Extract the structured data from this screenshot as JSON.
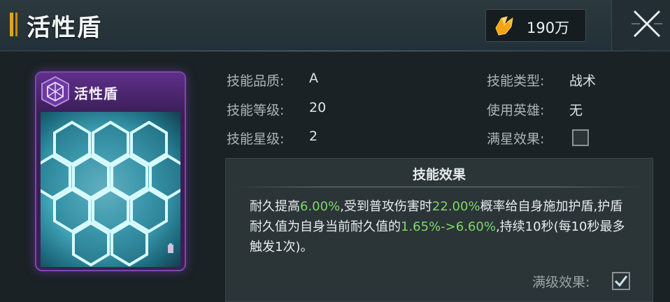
{
  "header": {
    "title": "活性盾",
    "currency_amount": "190万",
    "currency_icon": "crystal-icon",
    "close_icon": "close-icon",
    "accent_color": "#e0a51a"
  },
  "card": {
    "title": "活性盾",
    "badge_icon": "hexagon-badge-icon",
    "frame_color": "#7b4aa8"
  },
  "info": {
    "quality_label": "技能品质:",
    "quality_value": "A",
    "type_label": "技能类型:",
    "type_value": "战术",
    "level_label": "技能等级:",
    "level_value": "20",
    "hero_label": "使用英雄:",
    "hero_value": "无",
    "star_label": "技能星级:",
    "star_value": "2",
    "fullstar_label": "满星效果:",
    "fullstar_checked": false
  },
  "effect": {
    "title": "技能效果",
    "seg1": "耐久提高",
    "val1": "6.00%",
    "seg2": ",受到普攻伤害时",
    "val2": "22.00%",
    "seg3": "概率给自身施加护盾,护盾耐久值为自身当前耐久值的",
    "val3": "1.65%->6.60%",
    "seg4": ",持续10秒(每10秒最多触发1次)。",
    "highlight_color": "#7fd86a",
    "maxlevel_label": "满级效果:",
    "maxlevel_checked": true
  }
}
